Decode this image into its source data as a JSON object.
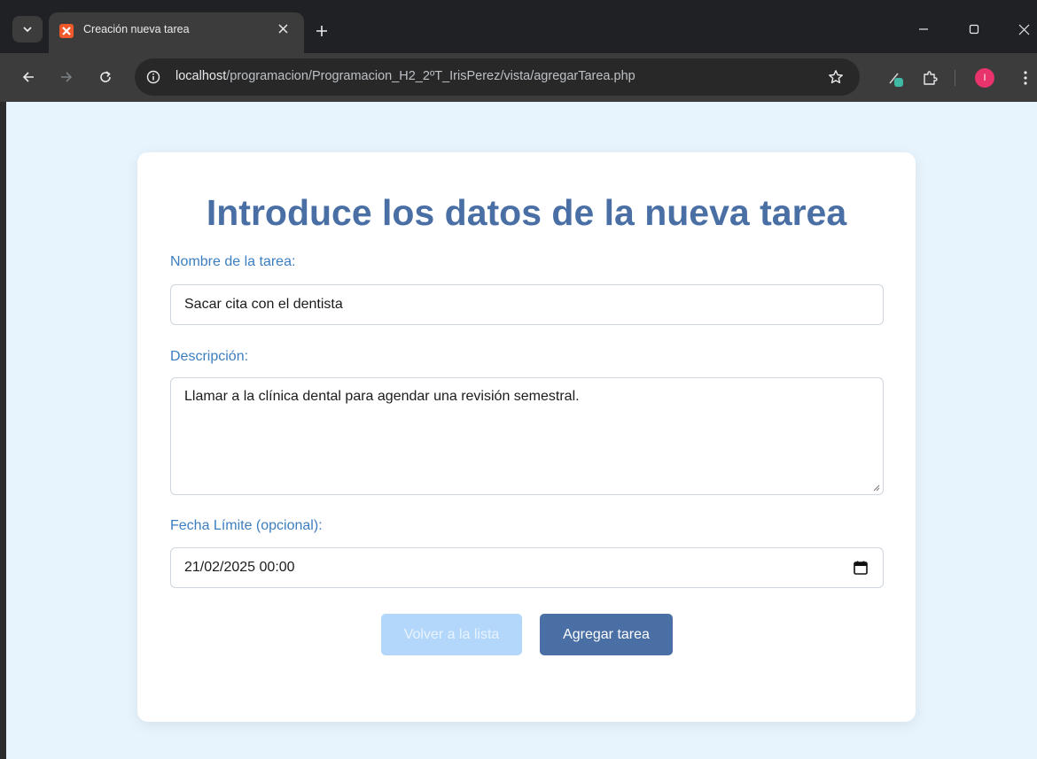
{
  "browser": {
    "tab_title": "Creación nueva tarea",
    "url_host": "localhost",
    "url_path": "/programacion/Programacion_H2_2ºT_IrisPerez/vista/agregarTarea.php",
    "profile_initial": "I"
  },
  "form": {
    "title": "Introduce los datos de la nueva tarea",
    "name_label": "Nombre de la tarea:",
    "name_value": "Sacar cita con el dentista",
    "description_label": "Descripción:",
    "description_value": "Llamar a la clínica dental para agendar una revisión semestral.",
    "date_label": "Fecha Límite (opcional):",
    "date_value": "21/02/2025 00:00",
    "back_button": "Volver a la lista",
    "submit_button": "Agregar tarea"
  },
  "colors": {
    "page_background": "#e8f4fd",
    "title": "#4a6fa5",
    "label": "#3c7ec0",
    "primary_button": "#4a6fa5",
    "secondary_button": "#b3d7fb",
    "favicon": "#f0592a",
    "avatar": "#e8336c"
  },
  "icons": [
    "tab-search-icon",
    "xampp-favicon-icon",
    "close-icon",
    "plus-icon",
    "minimize-icon",
    "maximize-icon",
    "back-arrow-icon",
    "forward-arrow-icon",
    "reload-icon",
    "info-icon",
    "star-icon",
    "eyedropper-extension-icon",
    "extensions-puzzle-icon",
    "more-vert-icon",
    "calendar-icon"
  ]
}
